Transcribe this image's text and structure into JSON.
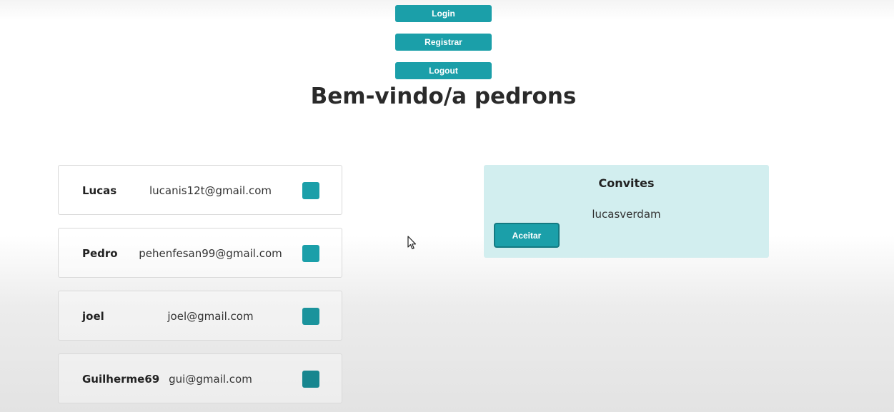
{
  "nav": {
    "login_label": "Login",
    "register_label": "Registrar",
    "logout_label": "Logout"
  },
  "welcome": {
    "title": "Bem-vindo/a pedrons"
  },
  "users": [
    {
      "name": "Lucas",
      "email": "lucanis12t@gmail.com"
    },
    {
      "name": "Pedro",
      "email": "pehenfesan99@gmail.com"
    },
    {
      "name": "joel",
      "email": "joel@gmail.com"
    },
    {
      "name": "Guilherme69",
      "email": "gui@gmail.com"
    }
  ],
  "invites": {
    "title": "Convites",
    "items": [
      {
        "name": "lucasverdam",
        "accept_label": "Aceitar"
      }
    ]
  },
  "colors": {
    "accent": "#1b9fa9",
    "invites_background": "#d2eeef"
  },
  "icons": {
    "cursor": "arrow-cursor-icon"
  }
}
